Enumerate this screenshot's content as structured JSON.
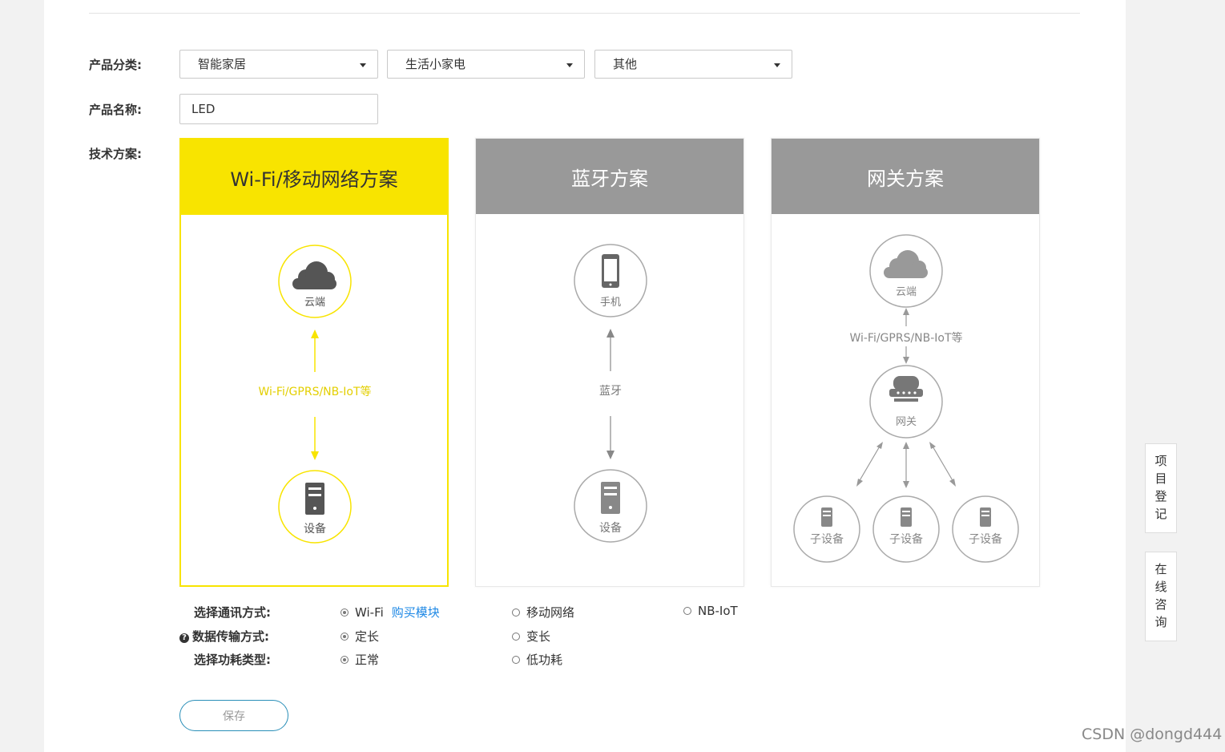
{
  "form": {
    "category_label": "产品分类:",
    "category_values": [
      "智能家居",
      "生活小家电",
      "其他"
    ],
    "name_label": "产品名称:",
    "name_value": "LED",
    "tech_label": "技术方案:"
  },
  "cards": [
    {
      "title": "Wi-Fi/移动网络方案",
      "selected": true,
      "top_node": "云端",
      "link_label": "Wi-Fi/GPRS/NB-IoT等",
      "bottom_node": "设备"
    },
    {
      "title": "蓝牙方案",
      "selected": false,
      "top_node": "手机",
      "link_label": "蓝牙",
      "bottom_node": "设备"
    },
    {
      "title": "网关方案",
      "selected": false,
      "top_node": "云端",
      "link_label": "Wi-Fi/GPRS/NB-IoT等",
      "middle_node": "网关",
      "sub_nodes": [
        "子设备",
        "子设备",
        "子设备"
      ]
    }
  ],
  "options": {
    "comm": {
      "label": "选择通讯方式:",
      "items": [
        "Wi-Fi",
        "移动网络",
        "NB-IoT"
      ],
      "selected": "Wi-Fi",
      "buy_link": "购买模块"
    },
    "transfer": {
      "label": "数据传输方式:",
      "help_icon": "question-circle-icon",
      "items": [
        "定长",
        "变长"
      ],
      "selected": "定长"
    },
    "power": {
      "label": "选择功耗类型:",
      "items": [
        "正常",
        "低功耗"
      ],
      "selected": "正常"
    }
  },
  "save_label": "保存",
  "side_buttons": [
    "项目登记",
    "在线咨询"
  ],
  "watermark": "CSDN @dongd444",
  "colors": {
    "accent": "#f8e400",
    "gray_header": "#999999",
    "link": "#1e88e5",
    "save_border": "#2a8fb8"
  }
}
